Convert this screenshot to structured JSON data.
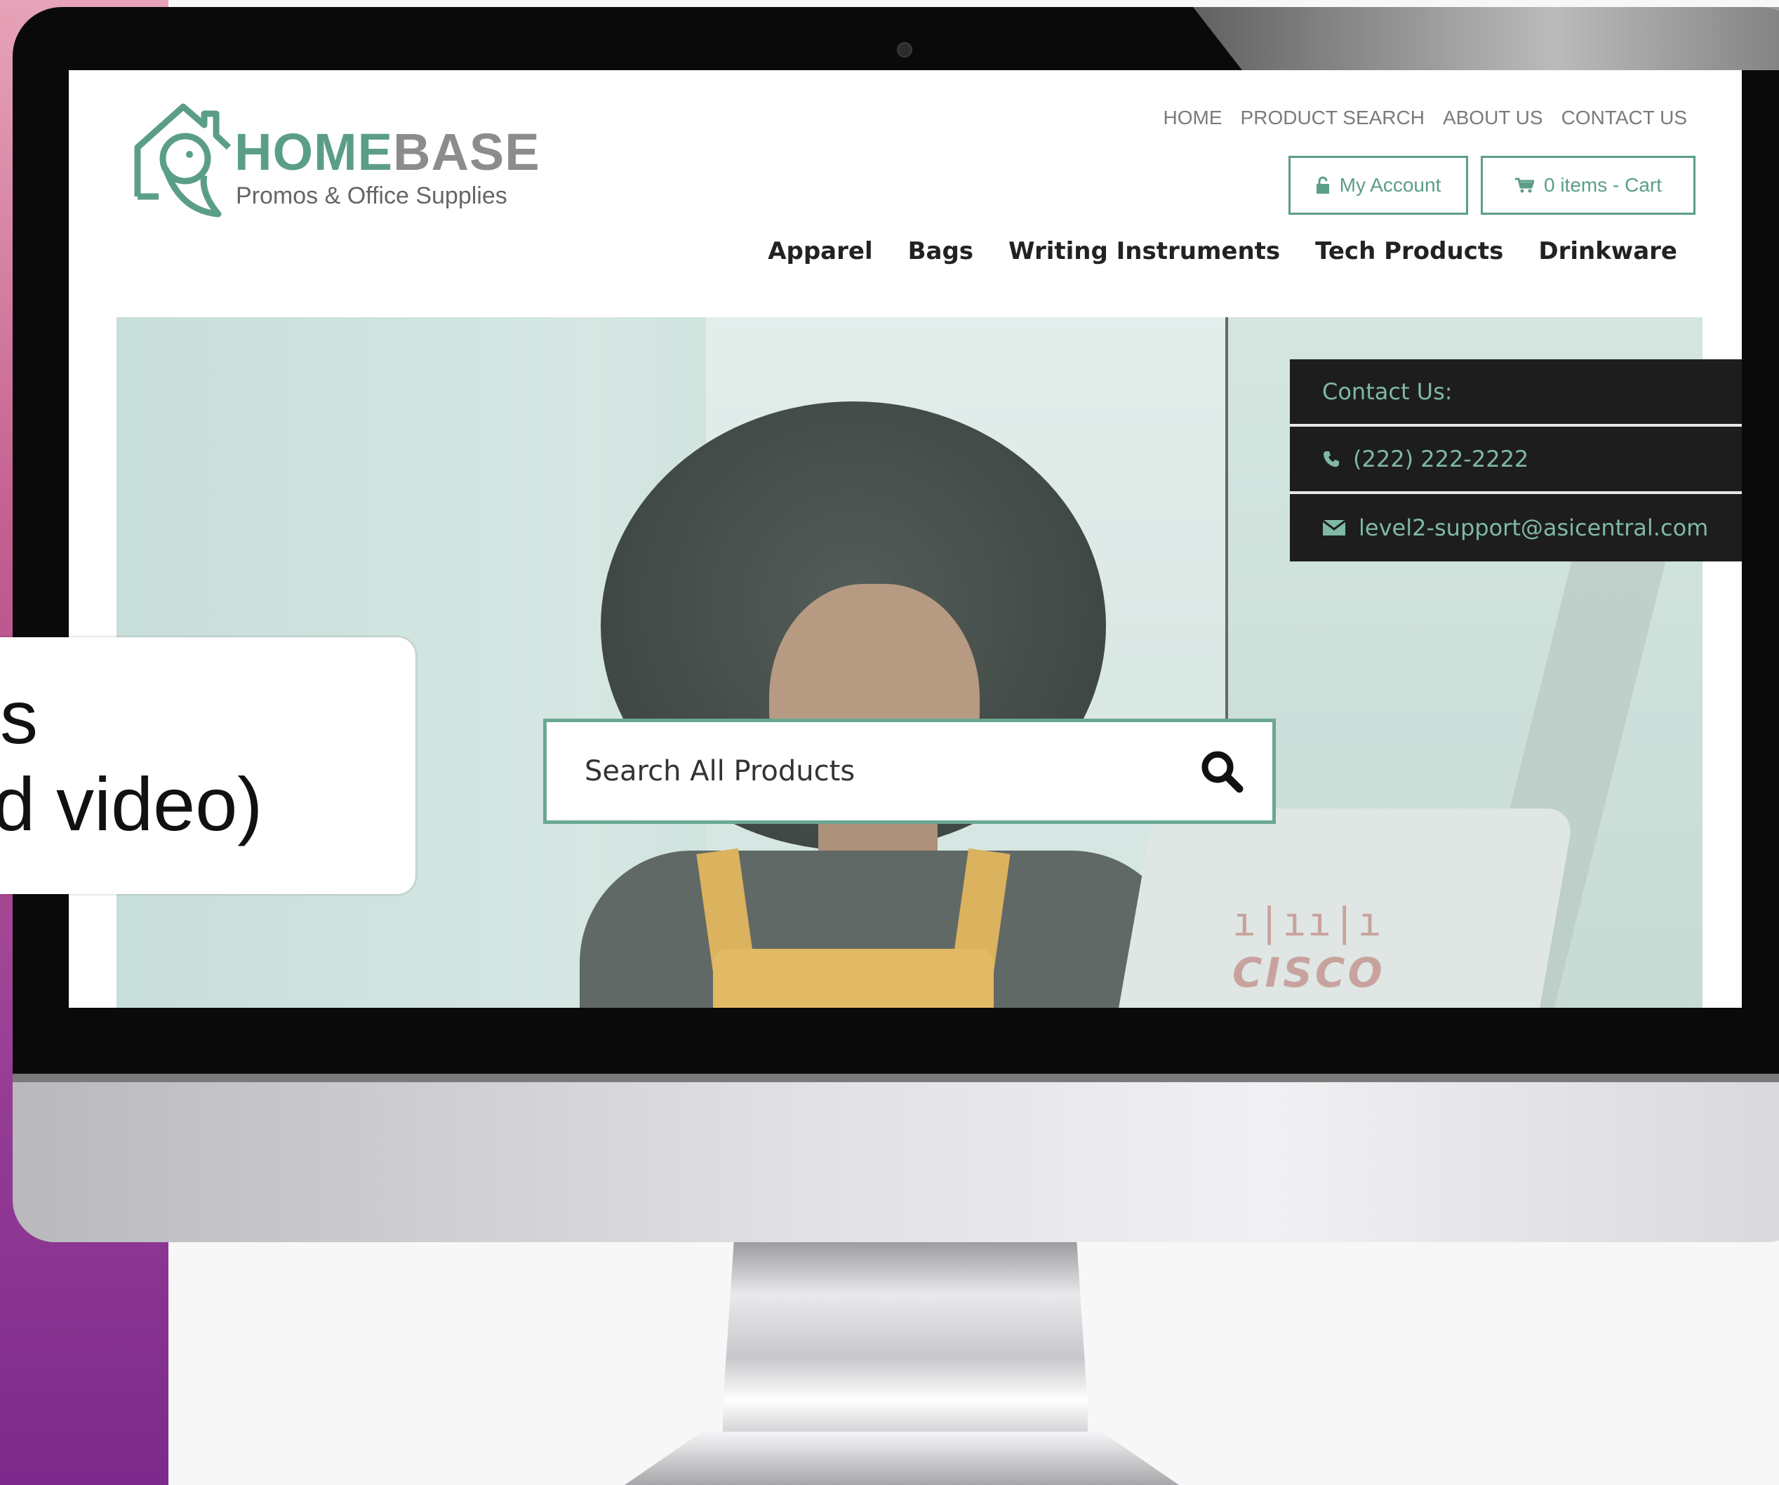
{
  "site": {
    "logo": {
      "title_part1": "HOME",
      "title_part2": "BASE",
      "subtitle": "Promos & Office Supplies"
    },
    "top_links": [
      "HOME",
      "PRODUCT SEARCH",
      "ABOUT US",
      "CONTACT US"
    ],
    "account_button": "My Account",
    "cart_button": "0 items - Cart",
    "main_nav": [
      "Apparel",
      "Bags",
      "Writing Instruments",
      "Tech Products",
      "Drinkware"
    ],
    "contact": {
      "heading": "Contact Us:",
      "phone": "(222) 222-2222",
      "email": "level2-support@asicentral.com"
    },
    "search": {
      "placeholder": "Search All Products"
    },
    "hero_brand_text": "CISCO",
    "hero_brand_bars": "ı|ıı|ı"
  },
  "callout": {
    "line1": "s",
    "line2": "d video)"
  },
  "colors": {
    "brand_green": "#5b9e86",
    "nav_dark": "#222222",
    "contact_bg": "#1d1d1d",
    "contact_text": "#7fb9a3"
  }
}
